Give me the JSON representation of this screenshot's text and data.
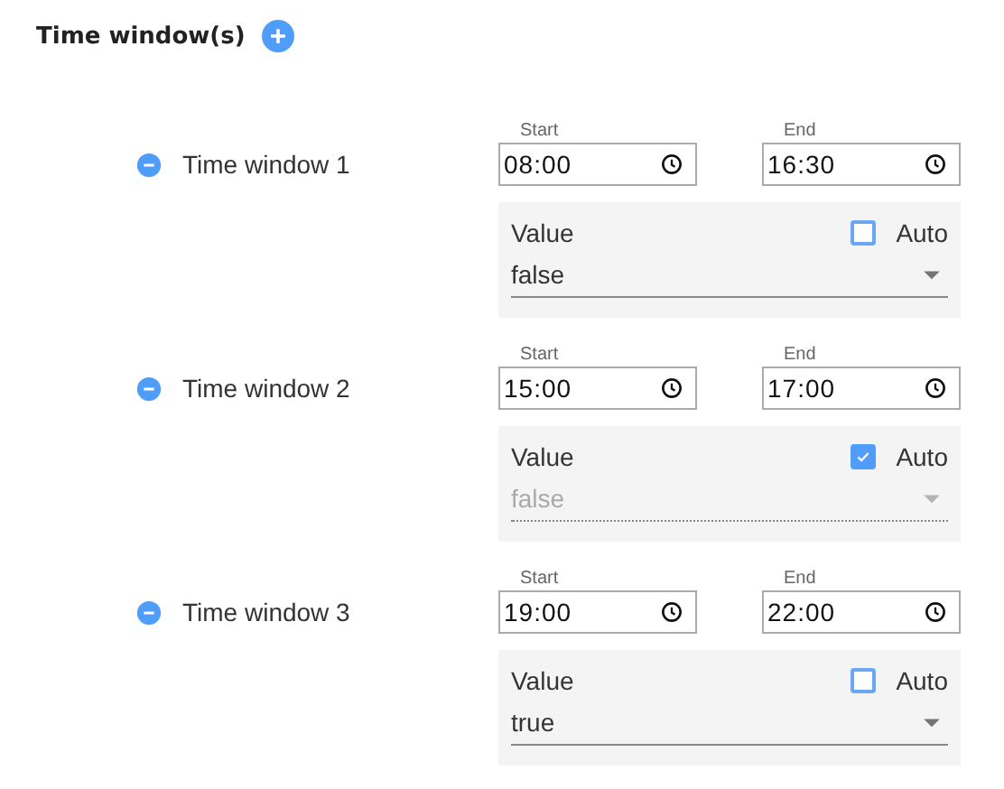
{
  "header": {
    "title": "Time window(s)"
  },
  "windows": [
    {
      "label": "Time window 1",
      "start_label": "Start",
      "start": "08:00",
      "end_label": "End",
      "end": "16:30",
      "value_label": "Value",
      "value": "false",
      "auto_label": "Auto",
      "auto": false
    },
    {
      "label": "Time window 2",
      "start_label": "Start",
      "start": "15:00",
      "end_label": "End",
      "end": "17:00",
      "value_label": "Value",
      "value": "false",
      "auto_label": "Auto",
      "auto": true
    },
    {
      "label": "Time window 3",
      "start_label": "Start",
      "start": "19:00",
      "end_label": "End",
      "end": "22:00",
      "value_label": "Value",
      "value": "true",
      "auto_label": "Auto",
      "auto": false
    }
  ]
}
